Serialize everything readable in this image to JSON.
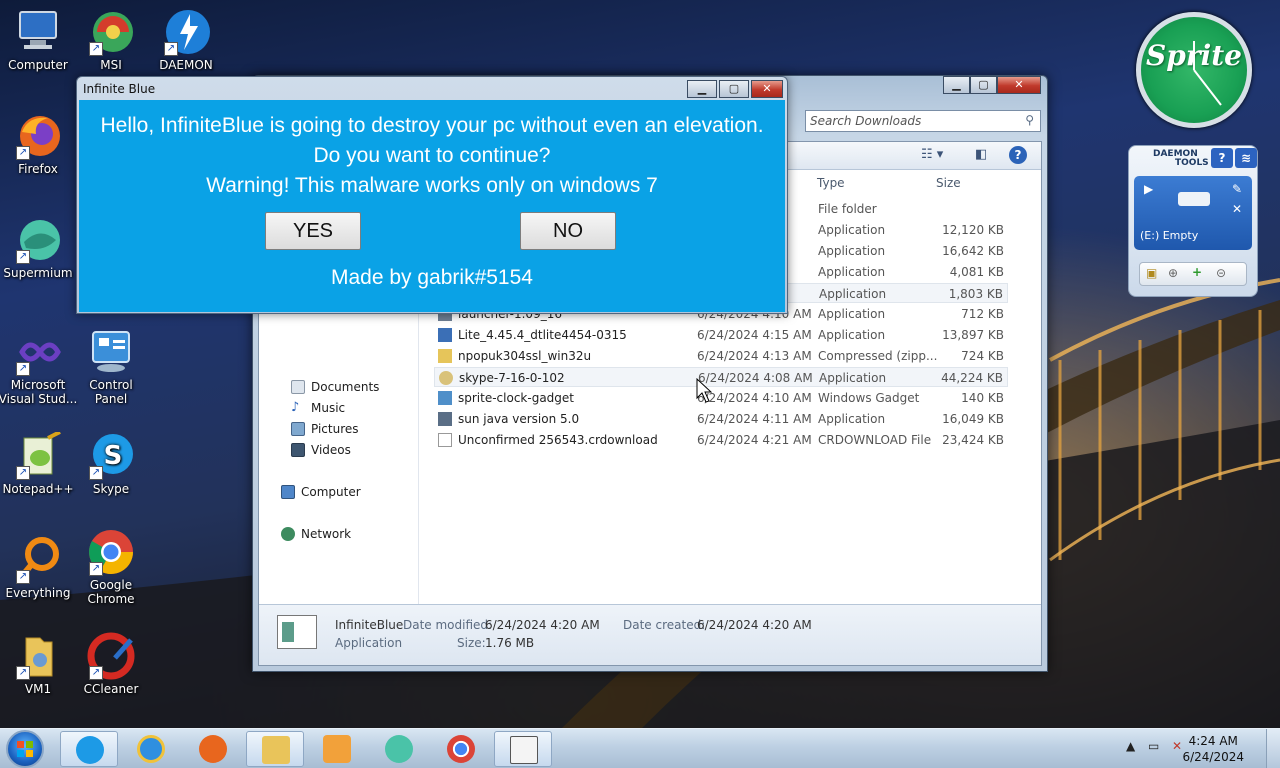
{
  "desktop": {
    "icons": [
      {
        "label": "Computer",
        "icon": "computer-icon"
      },
      {
        "label": "MSI",
        "icon": "msi-icon"
      },
      {
        "label": "DAEMON",
        "icon": "daemon-icon"
      },
      {
        "label": "Firefox",
        "icon": "firefox-icon"
      },
      {
        "label": "Supermium",
        "icon": "supermium-icon"
      },
      {
        "label": "Microsoft Visual Stud...",
        "icon": "visual-studio-icon"
      },
      {
        "label": "Control Panel",
        "icon": "control-panel-icon"
      },
      {
        "label": "Notepad++",
        "icon": "notepadpp-icon"
      },
      {
        "label": "Skype",
        "icon": "skype-icon"
      },
      {
        "label": "Everything",
        "icon": "everything-icon"
      },
      {
        "label": "Google Chrome",
        "icon": "chrome-icon"
      },
      {
        "label": "VM1",
        "icon": "folder-icon"
      },
      {
        "label": "CCleaner",
        "icon": "ccleaner-icon"
      }
    ]
  },
  "dialog": {
    "title": "Infinite Blue",
    "line1": "Hello, InfiniteBlue is going to destroy your pc without even an elevation.",
    "line2": "Do you want to continue?",
    "line3": "Warning! This malware works only on windows 7",
    "yes": "YES",
    "no": "NO",
    "credit": "Made by gabrik#5154"
  },
  "explorer": {
    "search_placeholder": "Search Downloads",
    "columns": {
      "type": "Type",
      "size": "Size"
    },
    "nav": {
      "documents": "Documents",
      "music": "Music",
      "pictures": "Pictures",
      "videos": "Videos",
      "computer": "Computer",
      "network": "Network"
    },
    "files": [
      {
        "name": "",
        "date": "",
        "type": "File folder",
        "size": ""
      },
      {
        "name": "",
        "date": "",
        "type": "Application",
        "size": "12,120 KB"
      },
      {
        "name": "",
        "date": "",
        "type": "Application",
        "size": "16,642 KB"
      },
      {
        "name": "",
        "date": "",
        "type": "Application",
        "size": "4,081 KB"
      },
      {
        "name": "",
        "date": "",
        "type": "Application",
        "size": "1,803 KB"
      },
      {
        "name": "launcher-1.09_16",
        "date": "6/24/2024 4:10 AM",
        "type": "Application",
        "size": "712 KB"
      },
      {
        "name": "Lite_4.45.4_dtlite4454-0315",
        "date": "6/24/2024 4:15 AM",
        "type": "Application",
        "size": "13,897 KB"
      },
      {
        "name": "npopuk304ssl_win32u",
        "date": "6/24/2024 4:13 AM",
        "type": "Compressed (zipp...",
        "size": "724 KB"
      },
      {
        "name": "skype-7-16-0-102",
        "date": "6/24/2024 4:08 AM",
        "type": "Application",
        "size": "44,224 KB"
      },
      {
        "name": "sprite-clock-gadget",
        "date": "6/24/2024 4:10 AM",
        "type": "Windows Gadget",
        "size": "140 KB"
      },
      {
        "name": "sun java version 5.0",
        "date": "6/24/2024 4:11 AM",
        "type": "Application",
        "size": "16,049 KB"
      },
      {
        "name": "Unconfirmed 256543.crdownload",
        "date": "6/24/2024 4:21 AM",
        "type": "CRDOWNLOAD File",
        "size": "23,424 KB"
      }
    ],
    "details": {
      "name": "InfiniteBlue",
      "kind": "Application",
      "modified_label": "Date modified:",
      "modified": "6/24/2024 4:20 AM",
      "created_label": "Date created:",
      "created": "6/24/2024 4:20 AM",
      "size_label": "Size:",
      "size": "1.76 MB"
    }
  },
  "gadgets": {
    "clock_brand": "Sprite",
    "daemon_header_1": "DAEMON",
    "daemon_header_2": "TOOLS",
    "daemon_help": "?",
    "daemon_drive": "(E:) Empty"
  },
  "taskbar": {
    "time": "4:24 AM",
    "date": "6/24/2024",
    "pinned": [
      "skype-icon",
      "internet-explorer-icon",
      "firefox-icon",
      "explorer-icon",
      "media-player-icon",
      "supermium-icon",
      "chrome-icon",
      "infiniteblue-icon"
    ]
  },
  "colors": {
    "dialog_body": "#0aa2e6",
    "taskbar": "#bdd0e3"
  }
}
